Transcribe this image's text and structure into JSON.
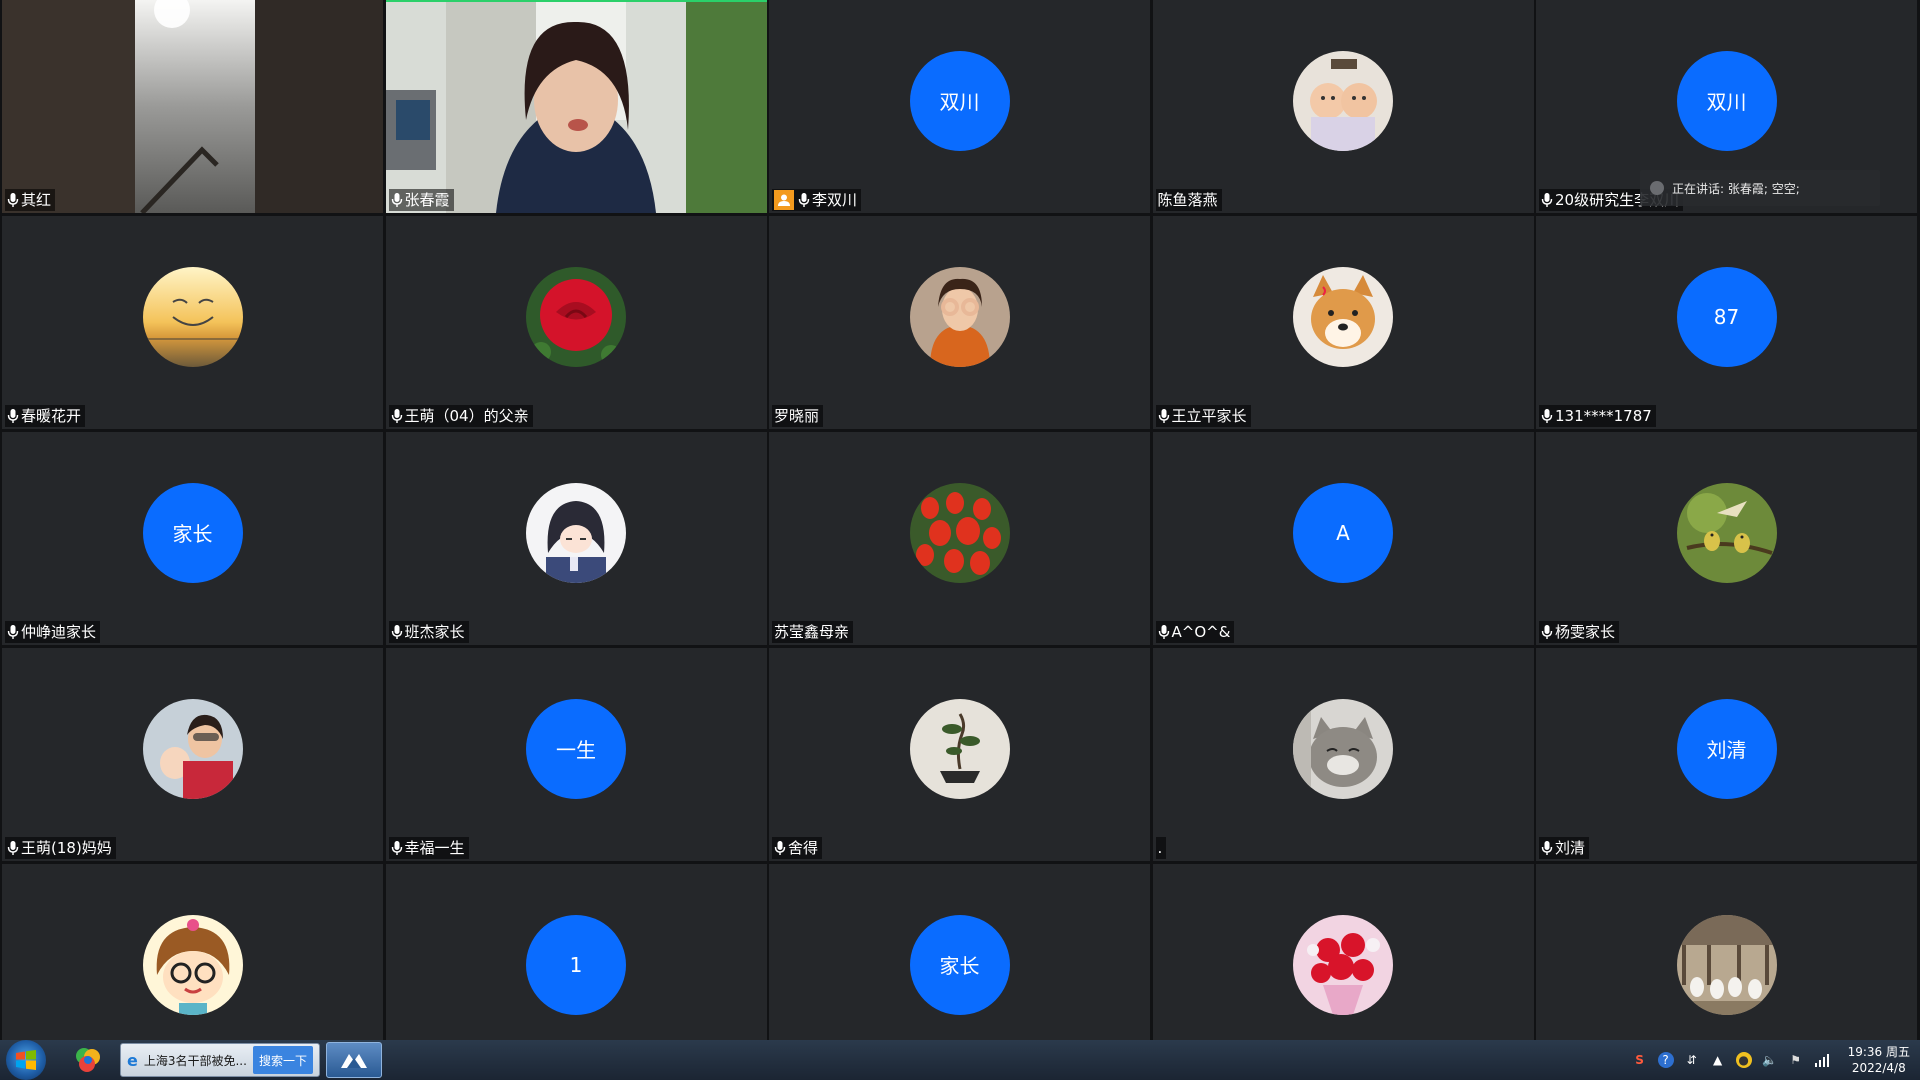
{
  "tiles": [
    {
      "name": "其红",
      "avatar": "video-hallway",
      "mic": true
    },
    {
      "name": "张春霞",
      "avatar": "video-presenter",
      "mic": true
    },
    {
      "name": "李双川",
      "avatar_text": "双川",
      "mic": true,
      "host": true
    },
    {
      "name": "陈鱼落燕",
      "avatar": "photo-twins",
      "mic": false
    },
    {
      "name": "20级研究生李双川",
      "avatar_text": "双川",
      "mic": true
    },
    {
      "name": "春暖花开",
      "avatar": "photo-sunset-smile",
      "mic": true
    },
    {
      "name": "王萌（04）的父亲",
      "avatar": "photo-red-rose",
      "mic": true
    },
    {
      "name": "罗晓丽",
      "avatar": "photo-woman-hands",
      "mic": false
    },
    {
      "name": "王立平家长",
      "avatar": "photo-shiba",
      "mic": true
    },
    {
      "name": "131****1787",
      "avatar_text": "87",
      "mic": true
    },
    {
      "name": "仲峥迪家长",
      "avatar_text": "家长",
      "mic": true
    },
    {
      "name": "班杰家长",
      "avatar": "photo-anime-girl",
      "mic": true
    },
    {
      "name": "苏莹鑫母亲",
      "avatar": "photo-tulips",
      "mic": false
    },
    {
      "name": "A^O^&",
      "avatar_text": "A",
      "mic": true
    },
    {
      "name": "杨雯家长",
      "avatar": "photo-birds",
      "mic": true
    },
    {
      "name": "王萌(18)妈妈",
      "avatar": "photo-family",
      "mic": true
    },
    {
      "name": "幸福一生",
      "avatar_text": "一生",
      "mic": true
    },
    {
      "name": "舍得",
      "avatar": "photo-bonsai",
      "mic": true
    },
    {
      "name": ".",
      "avatar": "photo-cat",
      "mic": false
    },
    {
      "name": "刘清",
      "avatar_text": "刘清",
      "mic": true
    },
    {
      "name": "",
      "avatar": "photo-cartoon-girl",
      "mic": false
    },
    {
      "name": "",
      "avatar_text": "1",
      "mic": false
    },
    {
      "name": "",
      "avatar_text": "家长",
      "mic": false
    },
    {
      "name": "",
      "avatar": "photo-bouquet",
      "mic": false
    },
    {
      "name": "",
      "avatar": "photo-geese",
      "mic": false
    }
  ],
  "speaking_banner": "正在讲话: 张春霞; 空空;",
  "taskbar": {
    "window_title": "上海3名干部被免...",
    "search_button": "搜索一下",
    "time": "19:36 周五",
    "date": "2022/4/8"
  },
  "colors": {
    "avatar_blue": "#0a6cff",
    "tile_bg": "#25272a",
    "host_badge": "#f39a1e"
  }
}
